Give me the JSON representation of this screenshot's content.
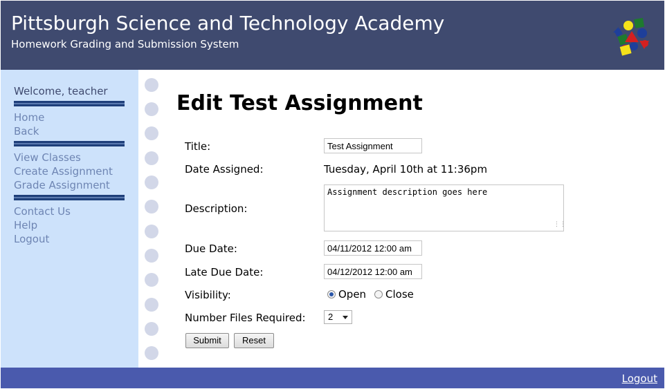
{
  "header": {
    "title": "Pittsburgh Science and Technology Academy",
    "subtitle": "Homework Grading and Submission System"
  },
  "sidebar": {
    "welcome": "Welcome, teacher",
    "group1": [
      "Home",
      "Back"
    ],
    "group2": [
      "View Classes",
      "Create Assignment",
      "Grade Assignment"
    ],
    "group3": [
      "Contact Us",
      "Help",
      "Logout"
    ]
  },
  "main": {
    "page_title": "Edit Test Assignment",
    "form": {
      "title_label": "Title:",
      "title_value": "Test Assignment",
      "date_assigned_label": "Date Assigned:",
      "date_assigned_value": "Tuesday, April 10th at 11:36pm",
      "description_label": "Description:",
      "description_value": "Assignment description goes here",
      "due_date_label": "Due Date:",
      "due_date_value": "04/11/2012 12:00 am",
      "late_due_date_label": "Late Due Date:",
      "late_due_date_value": "04/12/2012 12:00 am",
      "visibility_label": "Visibility:",
      "visibility_options": [
        "Open",
        "Close"
      ],
      "visibility_selected": "Open",
      "files_label": "Number Files Required:",
      "files_value": "2",
      "submit_label": "Submit",
      "reset_label": "Reset"
    }
  },
  "footer": {
    "logout": "Logout"
  },
  "colors": {
    "header_bg": "#3f4a6f",
    "sidebar_bg": "#cde2fb",
    "footer_bg": "#4a5aad",
    "nav_link": "#6e85b3"
  },
  "icons": {
    "logo": "colored-shapes-logo"
  }
}
